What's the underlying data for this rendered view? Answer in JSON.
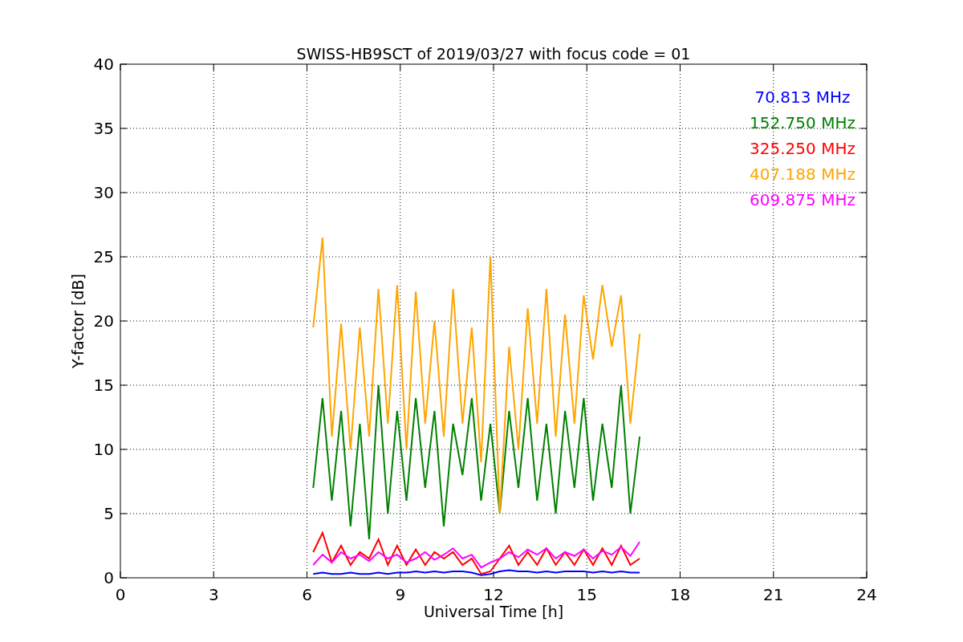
{
  "chart_data": {
    "type": "line",
    "grid": true,
    "title": "SWISS-HB9SCT of 2019/03/27 with focus code = 01",
    "xlabel": "Universal Time [h]",
    "ylabel": "Y-factor [dB]",
    "xlim": [
      0,
      24
    ],
    "ylim": [
      0,
      40
    ],
    "xticks": [
      0,
      3,
      6,
      9,
      12,
      15,
      18,
      21,
      24
    ],
    "yticks": [
      0,
      5,
      10,
      15,
      20,
      25,
      30,
      35,
      40
    ],
    "x": [
      6.2,
      6.5,
      6.8,
      7.1,
      7.4,
      7.7,
      8.0,
      8.3,
      8.6,
      8.9,
      9.2,
      9.5,
      9.8,
      10.1,
      10.4,
      10.7,
      11.0,
      11.3,
      11.6,
      11.9,
      12.2,
      12.5,
      12.8,
      13.1,
      13.4,
      13.7,
      14.0,
      14.3,
      14.6,
      14.9,
      15.2,
      15.5,
      15.8,
      16.1,
      16.4,
      16.7
    ],
    "series": [
      {
        "name": "70.813 MHz",
        "color": "#0000ff",
        "values": [
          0.3,
          0.4,
          0.3,
          0.3,
          0.4,
          0.3,
          0.3,
          0.4,
          0.3,
          0.4,
          0.4,
          0.5,
          0.4,
          0.5,
          0.4,
          0.5,
          0.5,
          0.4,
          0.2,
          0.3,
          0.5,
          0.6,
          0.5,
          0.5,
          0.4,
          0.5,
          0.4,
          0.5,
          0.5,
          0.5,
          0.4,
          0.5,
          0.4,
          0.5,
          0.4,
          0.4
        ]
      },
      {
        "name": "152.750 MHz",
        "color": "#008000",
        "values": [
          7,
          14,
          6,
          13,
          4,
          12,
          3,
          15,
          5,
          13,
          6,
          14,
          7,
          13,
          4,
          12,
          8,
          14,
          6,
          12,
          5,
          13,
          7,
          14,
          6,
          12,
          5,
          13,
          7,
          14,
          6,
          12,
          7,
          15,
          5,
          11
        ]
      },
      {
        "name": "325.250 MHz",
        "color": "#ff0000",
        "values": [
          2,
          3.5,
          1.2,
          2.5,
          1,
          2,
          1.5,
          3,
          1,
          2.5,
          1,
          2.2,
          1,
          2,
          1.5,
          2,
          1,
          1.5,
          0.3,
          0.5,
          1.5,
          2.5,
          1,
          2,
          1,
          2.3,
          1,
          2,
          1,
          2.2,
          1,
          2.3,
          1,
          2.5,
          1,
          1.5
        ]
      },
      {
        "name": "407.188 MHz",
        "color": "#ffa500",
        "values": [
          19.5,
          26.5,
          11,
          19.8,
          10,
          19.5,
          11,
          22.5,
          12,
          22.8,
          10,
          22.3,
          12,
          20,
          11,
          22.5,
          12,
          19.5,
          9,
          25,
          5,
          18,
          10,
          21,
          12,
          22.5,
          11,
          20.5,
          12,
          22,
          17,
          22.8,
          18,
          22,
          12,
          19
        ]
      },
      {
        "name": "609.875 MHz",
        "color": "#ff00ff",
        "values": [
          1,
          1.8,
          1.2,
          2,
          1.5,
          1.8,
          1.3,
          2,
          1.5,
          1.8,
          1.2,
          1.5,
          2,
          1.4,
          1.8,
          2.3,
          1.5,
          1.8,
          0.8,
          1.2,
          1.5,
          2,
          1.6,
          2.2,
          1.8,
          2.3,
          1.5,
          2,
          1.7,
          2.2,
          1.5,
          2.1,
          1.8,
          2.4,
          1.7,
          2.8
        ]
      }
    ]
  }
}
